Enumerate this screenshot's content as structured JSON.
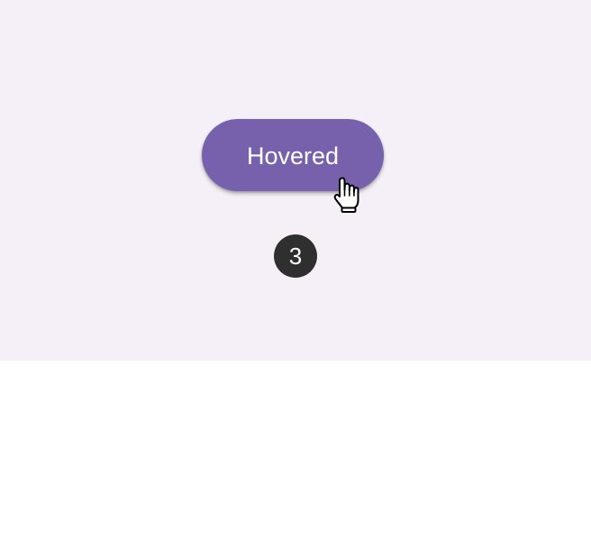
{
  "canvas": {
    "background": "#f5f0f8",
    "page_background": "#ffffff"
  },
  "button": {
    "label": "Hovered",
    "state": "hovered",
    "color": "#7761ad",
    "text_color": "#ffffff"
  },
  "counter": {
    "value": "3",
    "background": "#2f2f2f",
    "text_color": "#ffffff"
  },
  "cursor": {
    "icon": "hand-pointer-icon"
  }
}
